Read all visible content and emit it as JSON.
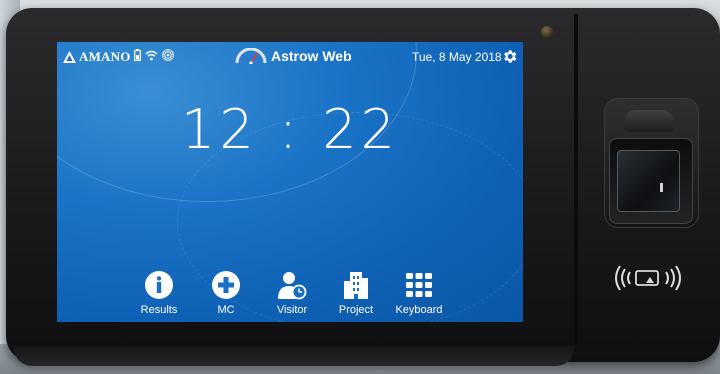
{
  "brand": {
    "name": "AMANO"
  },
  "app": {
    "title": "Astrow Web"
  },
  "status": {
    "date": "Tue, 8 May 2018"
  },
  "clock": {
    "time": "12:22"
  },
  "nav": {
    "items": [
      {
        "label": "Results",
        "icon": "info-icon"
      },
      {
        "label": "MC",
        "icon": "plus-icon"
      },
      {
        "label": "Visitor",
        "icon": "visitor-icon"
      },
      {
        "label": "Project",
        "icon": "building-icon"
      },
      {
        "label": "Keyboard",
        "icon": "keypad-icon"
      }
    ]
  },
  "colors": {
    "screen_bg": "#1b74c7",
    "device_body": "#1a1a1b",
    "text": "#ffffff"
  }
}
